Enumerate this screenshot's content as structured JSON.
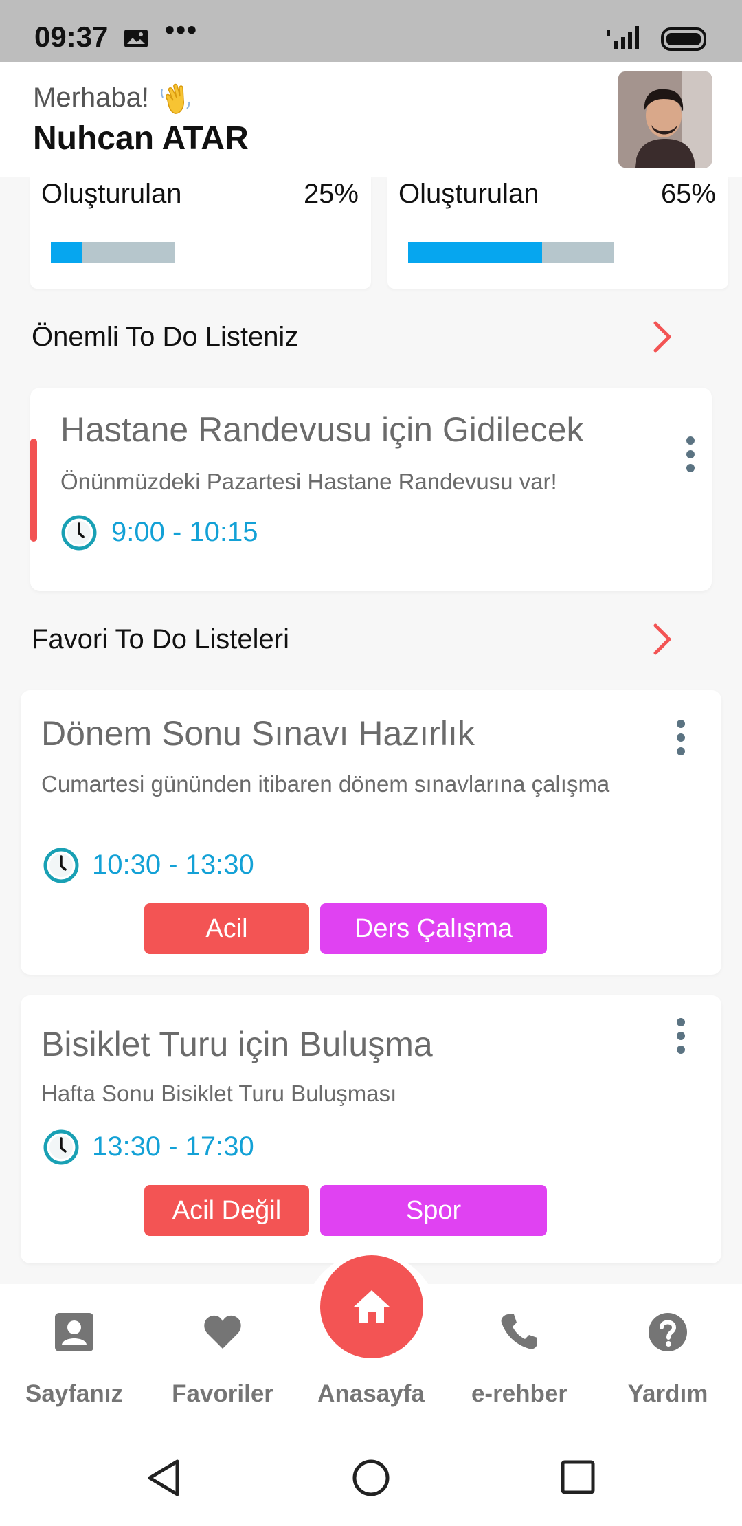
{
  "status_bar": {
    "time": "09:37",
    "dots": "•••",
    "icons": [
      "image-notification-icon",
      "signal-icon",
      "battery-icon"
    ]
  },
  "header": {
    "greeting": "Merhaba!",
    "greeting_emoji": "waving-hand-icon",
    "username": "Nuhcan ATAR",
    "avatar": "user-avatar-photo"
  },
  "progress_cards": [
    {
      "label": "Oluşturulan",
      "percent_text": "25%",
      "progress": 0.25
    },
    {
      "label": "Oluşturulan",
      "percent_text": "65%",
      "progress": 0.65
    }
  ],
  "important_section": {
    "title": "Önemli To Do Listeniz",
    "item": {
      "title": "Hastane Randevusu için Gidilecek",
      "description": "Önünmüzdeki Pazartesi Hastane Randevusu var!",
      "time": "9:00 - 10:15"
    }
  },
  "favorites_section": {
    "title": "Favori To Do Listeleri",
    "items": [
      {
        "title": "Dönem Sonu Sınavı Hazırlık",
        "description": "Cumartesi gününden itibaren dönem sınavlarına çalışma",
        "time": "10:30 - 13:30",
        "tags": [
          "Acil",
          "Ders Çalışma"
        ]
      },
      {
        "title": "Bisiklet Turu için Buluşma",
        "description": "Hafta Sonu Bisiklet Turu Buluşması",
        "time": "13:30 - 17:30",
        "tags": [
          "Acil Değil",
          "Spor"
        ]
      }
    ]
  },
  "bottom_nav": {
    "items": [
      {
        "label": "Sayfanız",
        "icon": "account-box-icon"
      },
      {
        "label": "Favoriler",
        "icon": "heart-icon"
      },
      {
        "label": "Anasayfa",
        "icon": "home-icon"
      },
      {
        "label": "e-rehber",
        "icon": "phone-icon"
      },
      {
        "label": "Yardım",
        "icon": "help-icon"
      }
    ]
  },
  "colors": {
    "accent_red": "#f35454",
    "tag_purple": "#e042f2",
    "time_blue": "#13a1d6",
    "progress_blue": "#06a6ef"
  }
}
